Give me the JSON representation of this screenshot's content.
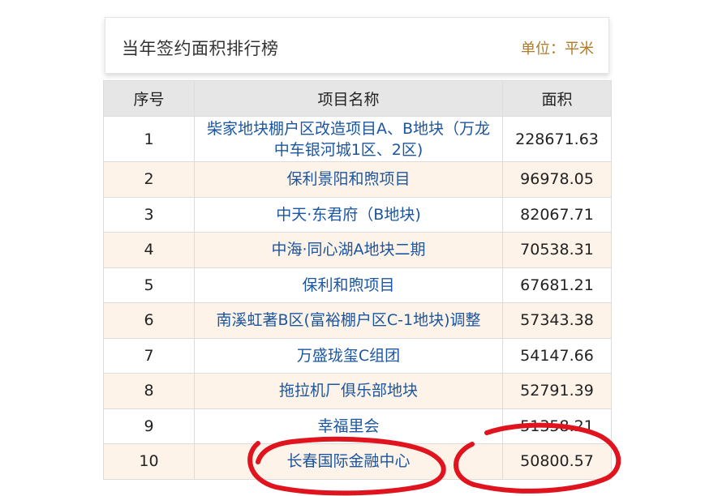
{
  "header": {
    "title": "当年签约面积排行榜",
    "unit": "单位：平米"
  },
  "table": {
    "columns": [
      "序号",
      "项目名称",
      "面积"
    ],
    "rows": [
      {
        "rank": "1",
        "name": "柴家地块棚户区改造项目A、B地块（万龙中车银河城1区、2区)",
        "area": "228671.63"
      },
      {
        "rank": "2",
        "name": "保利景阳和煦项目",
        "area": "96978.05"
      },
      {
        "rank": "3",
        "name": "中天·东君府（B地块)",
        "area": "82067.71"
      },
      {
        "rank": "4",
        "name": "中海·同心湖A地块二期",
        "area": "70538.31"
      },
      {
        "rank": "5",
        "name": "保利和煦项目",
        "area": "67681.21"
      },
      {
        "rank": "6",
        "name": "南溪虹著B区(富裕棚户区C-1地块)调整",
        "area": "57343.38"
      },
      {
        "rank": "7",
        "name": "万盛珑玺C组团",
        "area": "54147.66"
      },
      {
        "rank": "8",
        "name": "拖拉机厂俱乐部地块",
        "area": "52791.39"
      },
      {
        "rank": "9",
        "name": "幸福里会",
        "area": "51358.21"
      },
      {
        "rank": "10",
        "name": "长春国际金融中心",
        "area": "50800.57"
      }
    ]
  },
  "colors": {
    "header_bg": "#e6e6e6",
    "alt_row_bg": "#fdf3e8",
    "link_text": "#1c56a0",
    "unit_text": "#b07a2a",
    "annotation": "#e0141e"
  }
}
